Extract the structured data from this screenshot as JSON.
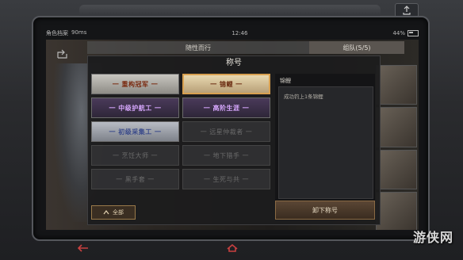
{
  "status": {
    "carrier": "角色档案",
    "network": "90ms",
    "time": "12:46",
    "battery": "44%"
  },
  "tabs": [
    {
      "label": "随性而行"
    },
    {
      "label": "组队(5/5)"
    }
  ],
  "panel": {
    "title": "称号"
  },
  "titles": [
    {
      "label": "一 重构冠军 一",
      "style": "silver"
    },
    {
      "label": "一 锦鲤 一",
      "style": "gold"
    },
    {
      "label": "一 中级护航工 一",
      "style": "purple"
    },
    {
      "label": "一 高阶生涯 一",
      "style": "purple"
    },
    {
      "label": "一 初级采集工 一",
      "style": "blue"
    },
    {
      "label": "一 远星仲裁者 一",
      "style": "locked"
    },
    {
      "label": "一 烹饪大师 一",
      "style": "locked"
    },
    {
      "label": "一 地下猎手 一",
      "style": "locked"
    },
    {
      "label": "一 黑手套 一",
      "style": "locked"
    },
    {
      "label": "一 生死与共 一",
      "style": "locked"
    }
  ],
  "filter": {
    "label": "全部"
  },
  "detail": {
    "name": "锦鲤",
    "description": "成功钓上1条锦鲤",
    "unequip_label": "卸下称号"
  },
  "watermark": "游侠网"
}
